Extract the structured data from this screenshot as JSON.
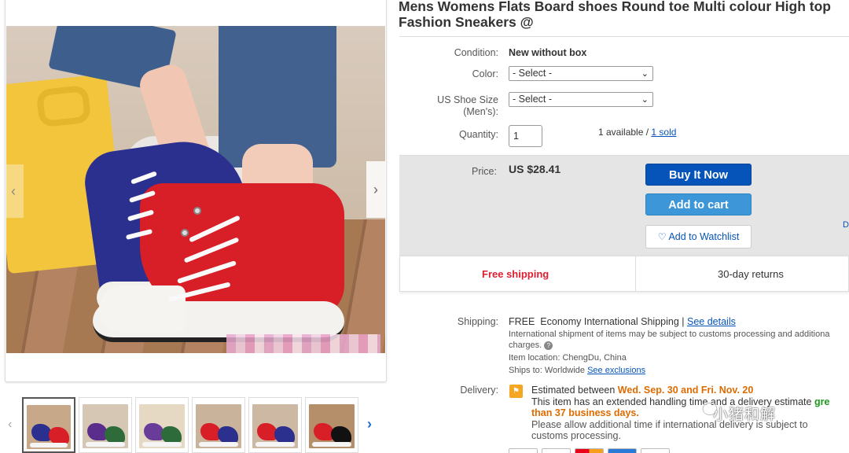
{
  "product": {
    "title": "Mens Womens Flats Board shoes Round toe Multi colour High top Fashion Sneakers @"
  },
  "gallery": {
    "prev_icon": "‹",
    "next_icon": "›",
    "thumb_prev_icon": "‹",
    "thumb_next_icon": "›",
    "thumbnails": [
      {
        "colors": [
          "#2b2f8e",
          "#d81e26"
        ],
        "bg": "#c7a98a",
        "selected": true
      },
      {
        "colors": [
          "#5a2d8c",
          "#2e6b3a"
        ],
        "bg": "#d6c7b4",
        "selected": false
      },
      {
        "colors": [
          "#6a3c9a",
          "#2e6b3a"
        ],
        "bg": "#e6d9c3",
        "selected": false
      },
      {
        "colors": [
          "#d81e26",
          "#2b2f8e"
        ],
        "bg": "#c9b39a",
        "selected": false
      },
      {
        "colors": [
          "#d81e26",
          "#2b2f8e"
        ],
        "bg": "#cdb9a3",
        "selected": false
      },
      {
        "colors": [
          "#d81e26",
          "#111111"
        ],
        "bg": "#b58f6a",
        "selected": false
      }
    ]
  },
  "details": {
    "condition_label": "Condition:",
    "condition_value": "New without box",
    "color_label": "Color:",
    "color_select": "- Select -",
    "size_label_line1": "US Shoe Size",
    "size_label_line2": "(Men's):",
    "size_select": "- Select -",
    "quantity_label": "Quantity:",
    "quantity_value": "1",
    "available_text": "1 available / ",
    "sold_link": "1 sold"
  },
  "buybox": {
    "price_label": "Price:",
    "price": "US $28.41",
    "buy_now": "Buy It Now",
    "add_to_cart": "Add to cart",
    "watchlist": "Add to Watchlist",
    "edge_fragment": "D"
  },
  "shipping_bar": {
    "free_shipping": "Free shipping",
    "returns": "30-day returns"
  },
  "shipping": {
    "label": "Shipping:",
    "free": "FREE",
    "method": "Economy International Shipping | ",
    "see_details": "See details",
    "customs_line1": "International shipment of items may be subject to customs processing and additiona",
    "customs_line2": "charges.",
    "location": "Item location:  ChengDu, China",
    "ships_to": "Ships to:  Worldwide  ",
    "see_exclusions": "See exclusions"
  },
  "delivery": {
    "label": "Delivery:",
    "estimated_prefix": "Estimated between ",
    "estimated_dates": "Wed. Sep. 30 and Fri. Nov. 20",
    "handling_line1": "This item has an extended handling time and a delivery estimate ",
    "handling_green": "gre",
    "handling_line2": "than 37 business days.",
    "allow_line1": "Please allow additional time if international delivery is subject to",
    "allow_line2": "customs processing."
  },
  "watermark": {
    "text": "小猪和解"
  }
}
